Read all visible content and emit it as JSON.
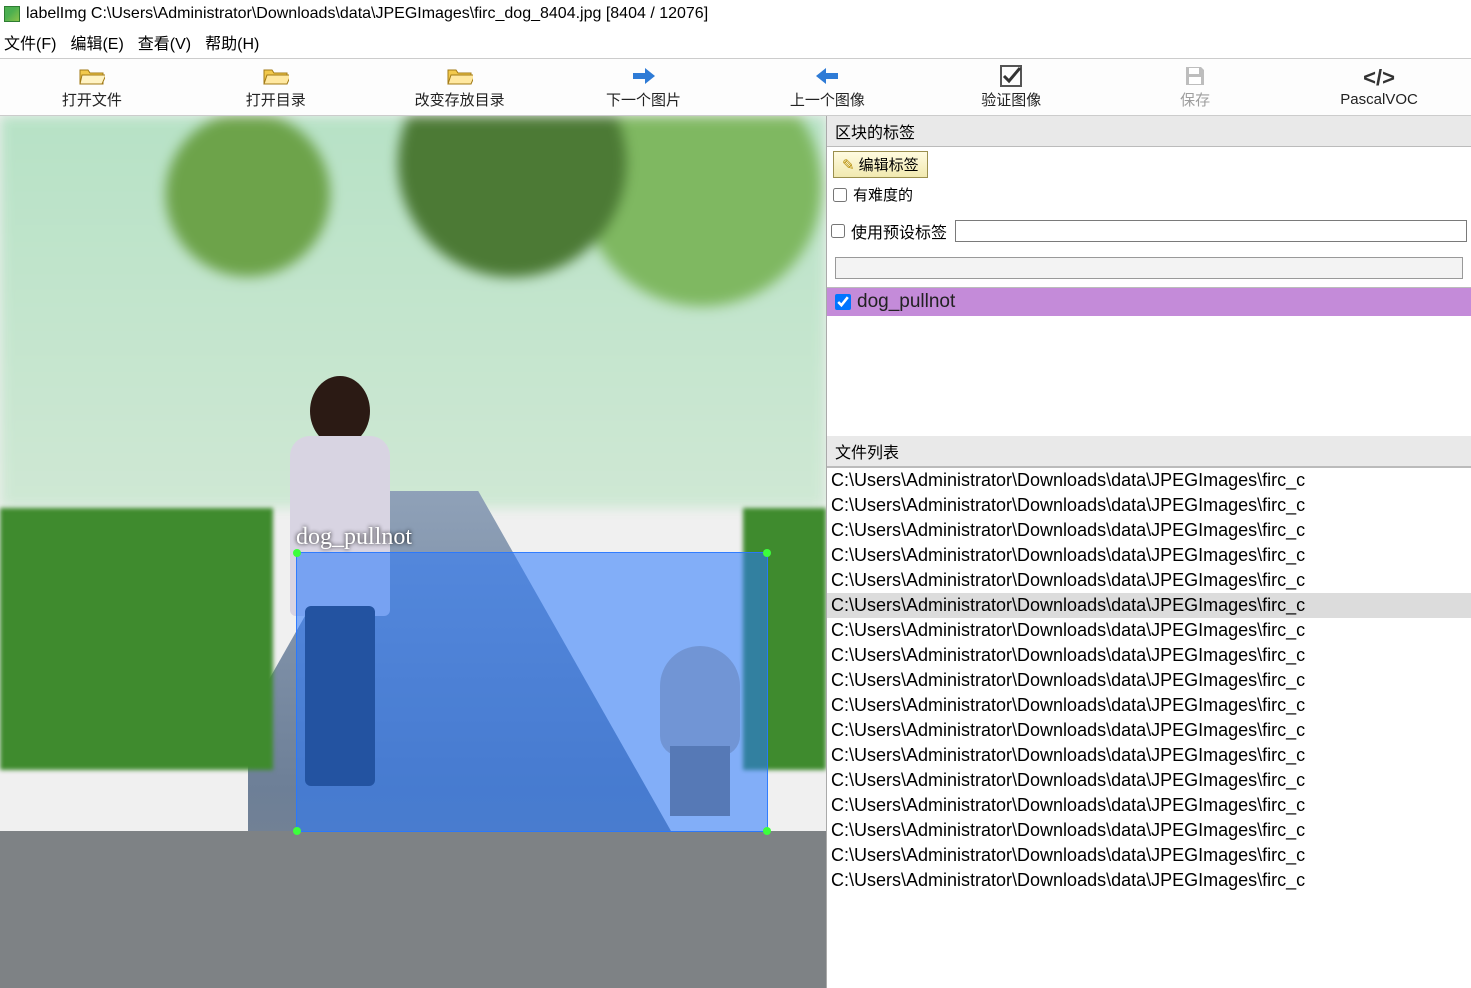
{
  "title": "labelImg C:\\Users\\Administrator\\Downloads\\data\\JPEGImages\\firc_dog_8404.jpg [8404 / 12076]",
  "menu": {
    "file": "文件(F)",
    "edit": "编辑(E)",
    "view": "查看(V)",
    "help": "帮助(H)"
  },
  "toolbar": {
    "open": "打开文件",
    "open_dir": "打开目录",
    "change_save_dir": "改变存放目录",
    "next": "下一个图片",
    "prev": "上一个图像",
    "verify": "验证图像",
    "save": "保存",
    "format": "PascalVOC"
  },
  "bbox_label": "dog_pullnot",
  "panels": {
    "box_labels_header": "区块的标签",
    "edit_label_btn": "编辑标签",
    "difficult": "有难度的",
    "use_default_label": "使用预设标签",
    "default_label_value": "",
    "label_item": "dog_pullnot",
    "file_list_header": "文件列表"
  },
  "file_path_prefix": "C:\\Users\\Administrator\\Downloads\\data\\JPEGImages\\firc_c",
  "selected_file_index": 5,
  "file_count": 17
}
